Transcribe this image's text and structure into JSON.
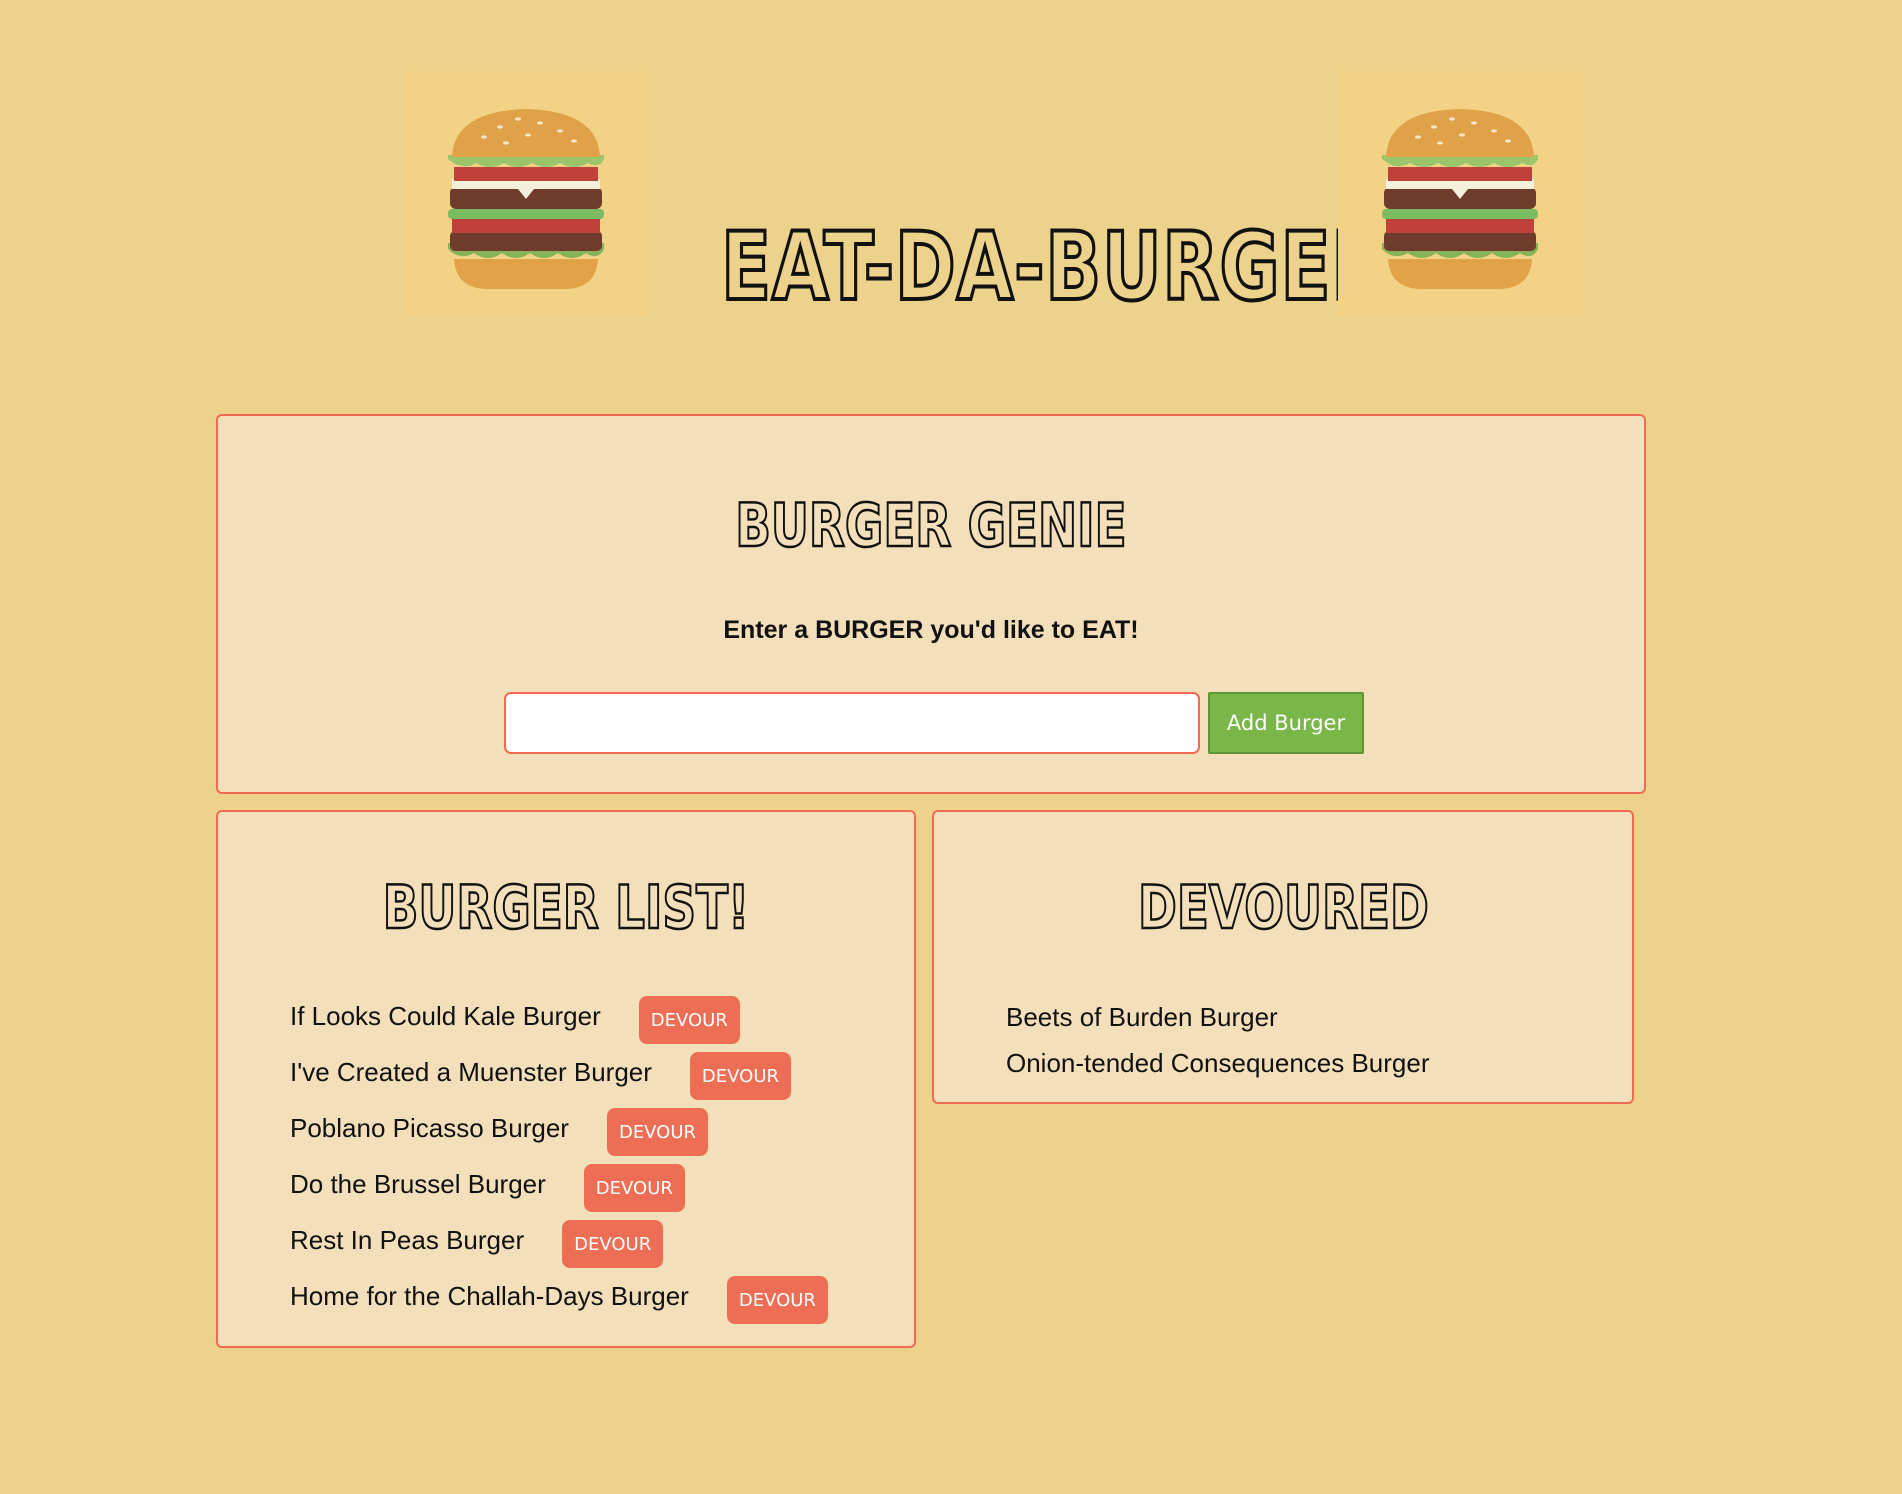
{
  "header": {
    "title": "EAT-DA-BURGER",
    "logo_icon": "burger-icon"
  },
  "genie": {
    "heading": "BURGER GENIE",
    "prompt": "Enter a BURGER you'd like to EAT!",
    "input_value": "",
    "input_placeholder": "",
    "add_label": "Add Burger"
  },
  "burger_list": {
    "heading": "BURGER LIST!",
    "devour_label": "DEVOUR",
    "items": [
      {
        "name": "If Looks Could Kale Burger"
      },
      {
        "name": "I've Created a Muenster Burger"
      },
      {
        "name": "Poblano Picasso Burger"
      },
      {
        "name": "Do the Brussel Burger"
      },
      {
        "name": "Rest In Peas Burger"
      },
      {
        "name": "Home for the Challah-Days Burger"
      }
    ]
  },
  "devoured": {
    "heading": "DEVOURED",
    "items": [
      {
        "name": "Beets of Burden Burger"
      },
      {
        "name": "Onion-tended Consequences Burger"
      }
    ]
  },
  "colors": {
    "page_background": "#ecd28b",
    "panel_background": "#f3dfb9",
    "panel_border": "#ef6a52",
    "add_button": "#7ab648",
    "devour_button": "#ee6e55"
  }
}
